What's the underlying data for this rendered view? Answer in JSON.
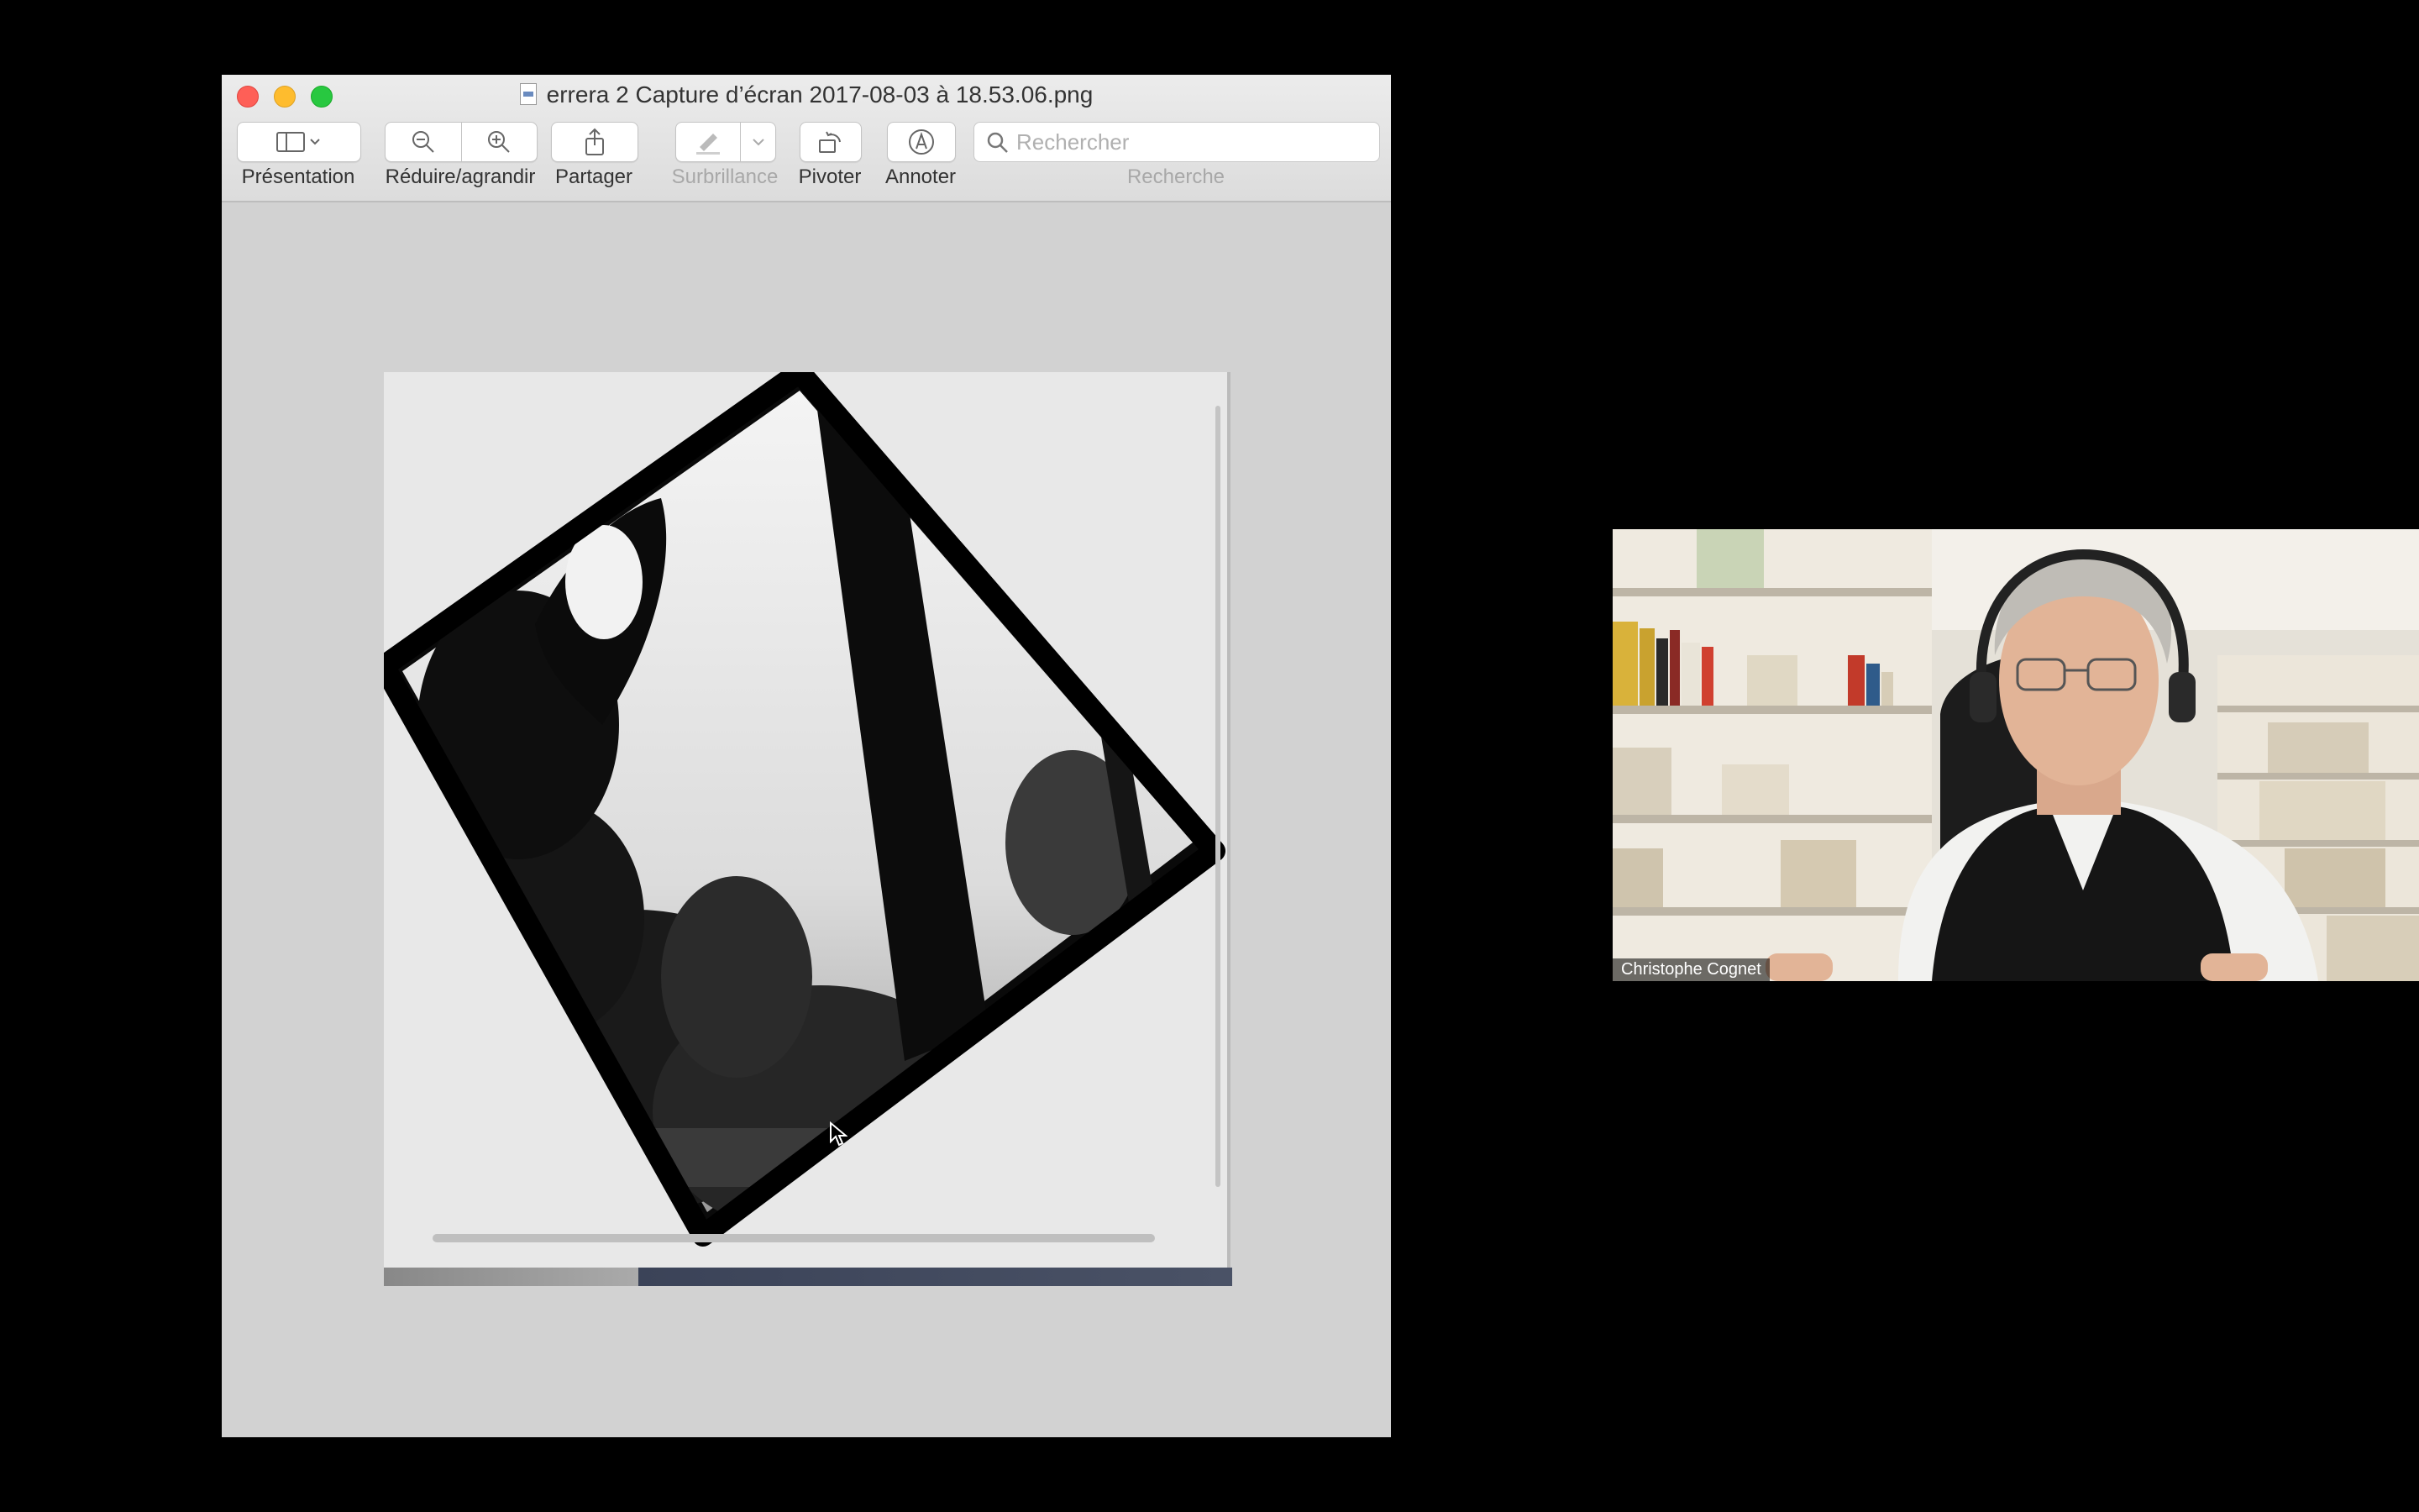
{
  "window": {
    "title": "errera 2 Capture d’écran 2017-08-03 à 18.53.06.png",
    "file_icon": "png-file-icon"
  },
  "toolbar": {
    "presentation_label": "Présentation",
    "zoom_label": "Réduire/agrandir",
    "share_label": "Partager",
    "highlight_label": "Surbrillance",
    "rotate_label": "Pivoter",
    "annotate_label": "Annoter",
    "search_label": "Recherche",
    "search_placeholder": "Rechercher"
  },
  "video": {
    "participant_name": "Christophe Cognet"
  },
  "colors": {
    "close": "#fe5f57",
    "minimize": "#febc2e",
    "zoom": "#28c840"
  }
}
